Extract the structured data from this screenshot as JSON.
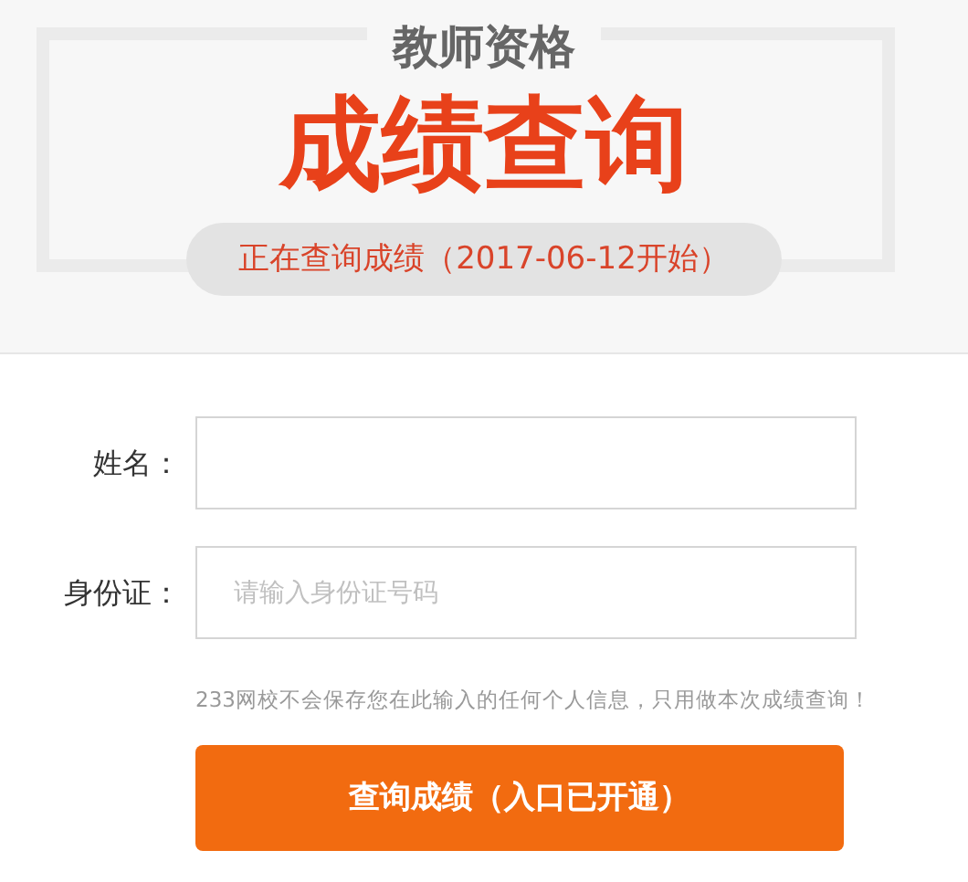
{
  "banner": {
    "subtitle": "教师资格",
    "title": "成绩查询",
    "notice": "正在查询成绩（2017-06-12开始）"
  },
  "form": {
    "fields": [
      {
        "label": "姓名："
      },
      {
        "label": "身份证：",
        "placeholder": "请输入身份证号码"
      }
    ],
    "note": "233网校不会保存您在此输入的任何个人信息，只用做本次成绩查询！",
    "submit": "查询成绩（入口已开通）"
  }
}
